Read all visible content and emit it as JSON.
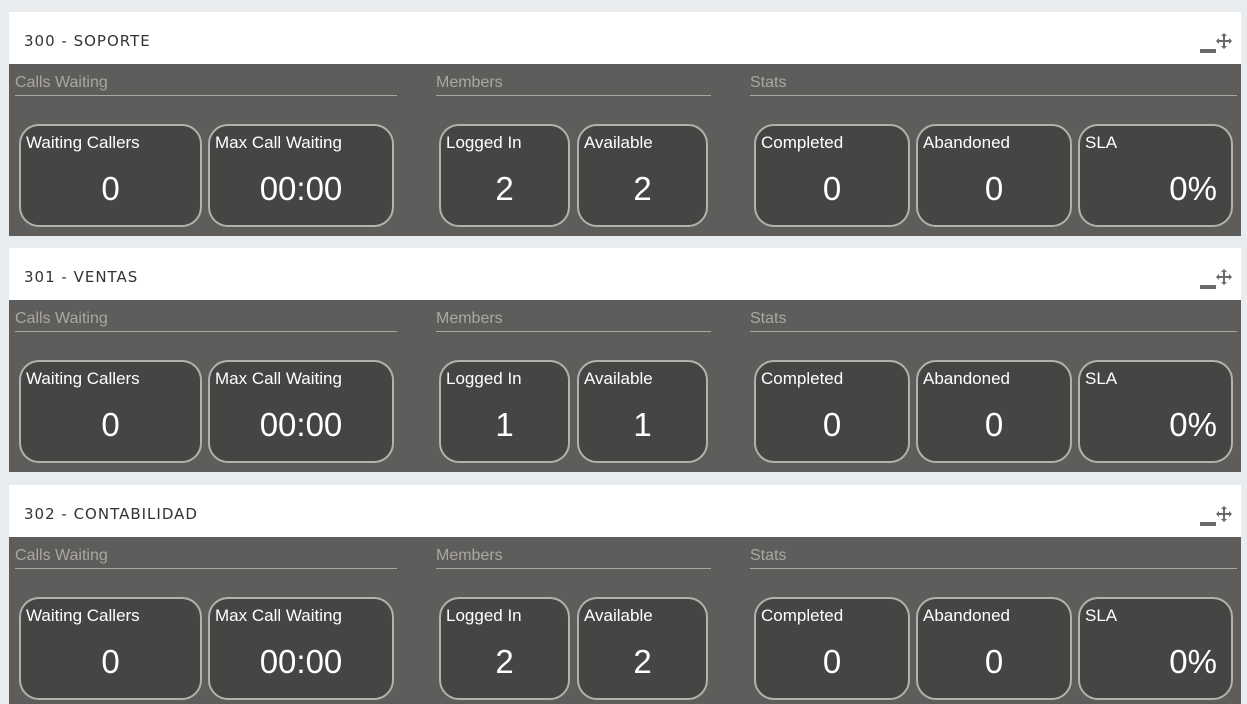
{
  "panels": [
    {
      "title": "300 - SOPORTE",
      "sections": {
        "calls": "Calls Waiting",
        "members": "Members",
        "stats": "Stats"
      },
      "cards": {
        "waiting_callers": {
          "label": "Waiting Callers",
          "value": "0"
        },
        "max_call_waiting": {
          "label": "Max Call Waiting",
          "value": "00:00"
        },
        "logged_in": {
          "label": "Logged In",
          "value": "2"
        },
        "available": {
          "label": "Available",
          "value": "2"
        },
        "completed": {
          "label": "Completed",
          "value": "0"
        },
        "abandoned": {
          "label": "Abandoned",
          "value": "0"
        },
        "sla": {
          "label": "SLA",
          "value": "0%"
        }
      }
    },
    {
      "title": "301 - VENTAS",
      "sections": {
        "calls": "Calls Waiting",
        "members": "Members",
        "stats": "Stats"
      },
      "cards": {
        "waiting_callers": {
          "label": "Waiting Callers",
          "value": "0"
        },
        "max_call_waiting": {
          "label": "Max Call Waiting",
          "value": "00:00"
        },
        "logged_in": {
          "label": "Logged In",
          "value": "1"
        },
        "available": {
          "label": "Available",
          "value": "1"
        },
        "completed": {
          "label": "Completed",
          "value": "0"
        },
        "abandoned": {
          "label": "Abandoned",
          "value": "0"
        },
        "sla": {
          "label": "SLA",
          "value": "0%"
        }
      }
    },
    {
      "title": "302 - CONTABILIDAD",
      "sections": {
        "calls": "Calls Waiting",
        "members": "Members",
        "stats": "Stats"
      },
      "cards": {
        "waiting_callers": {
          "label": "Waiting Callers",
          "value": "0"
        },
        "max_call_waiting": {
          "label": "Max Call Waiting",
          "value": "00:00"
        },
        "logged_in": {
          "label": "Logged In",
          "value": "2"
        },
        "available": {
          "label": "Available",
          "value": "2"
        },
        "completed": {
          "label": "Completed",
          "value": "0"
        },
        "abandoned": {
          "label": "Abandoned",
          "value": "0"
        },
        "sla": {
          "label": "SLA",
          "value": "0%"
        }
      }
    }
  ],
  "icons": {
    "minimize": "minimize-icon",
    "move": "move-icon"
  },
  "colors": {
    "panel_body": "#5f5d5b",
    "card_bg": "#474544",
    "card_border": "#b3b1ae",
    "section_label": "#a9a7a4",
    "header_bg": "#ffffff"
  }
}
